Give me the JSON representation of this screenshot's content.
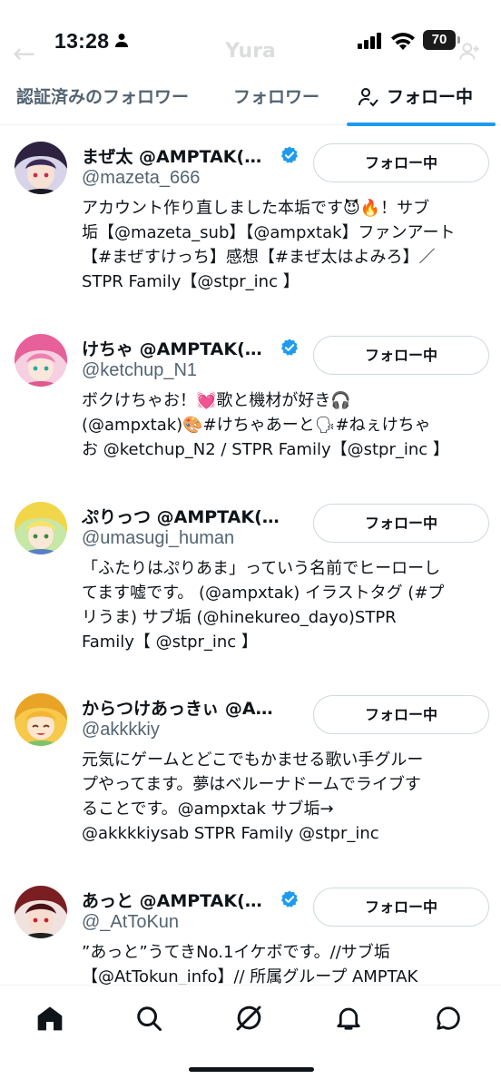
{
  "status_bar": {
    "time": "13:28",
    "battery": "70"
  },
  "header_ghost": {
    "title": "Yura"
  },
  "tabs": [
    {
      "label": "認証済みのフォロワー"
    },
    {
      "label": "フォロワー"
    },
    {
      "label": "フォロー中",
      "active": true
    }
  ],
  "users": [
    {
      "name": "まぜ太 @AMPTAK(ア…",
      "handle": "@mazeta_666",
      "button": "フォロー中",
      "verified": true,
      "bio": [
        "アカウント作り直しました本垢です😈🔥！サブ",
        "垢【@mazeta_sub】【@ampxtak】ファンアート",
        "【#まぜすけっち】感想【#まぜ太はよみろ】／",
        "STPR Family【@stpr_inc 】"
      ]
    },
    {
      "name": "けちゃ @AMPTAK(ア…",
      "handle": "@ketchup_N1",
      "button": "フォロー中",
      "verified": true,
      "bio": [
        "ボクけちゃお！💓歌と機材が好き🎧",
        "(@ampxtak)🎨#けちゃあーと🗣#ねぇけちゃ",
        "お @ketchup_N2 / STPR Family【@stpr_inc 】"
      ]
    },
    {
      "name": "ぷりっつ @AMPTAK(ア…",
      "handle": "@umasugi_human",
      "button": "フォロー中",
      "verified": false,
      "bio": [
        "「ふたりはぷりあま」っていう名前でヒーローし",
        "てます嘘です。 (@ampxtak) イラストタグ (#プ",
        "リうま) サブ垢 (@hinekureo_dayo)STPR",
        "Family【 @stpr_inc 】"
      ]
    },
    {
      "name": "からつけあっきぃ @AM…",
      "handle": "@akkkkiy",
      "button": "フォロー中",
      "verified": false,
      "bio": [
        "元気にゲームとどこでもかませる歌い手グルー",
        "プやってます。夢はベルーナドームでライブす",
        "ることです。@ampxtak サブ垢→",
        "@akkkkiysab STPR Family @stpr_inc"
      ]
    },
    {
      "name": "あっと @AMPTAK(ア…",
      "handle": "@_AtToKun",
      "button": "フォロー中",
      "verified": true,
      "bio": [
        "”あっと”うてきNo.1イケボです。//サブ垢",
        "【@AtTokun_info】// 所属グループ AMPTAK"
      ]
    }
  ],
  "bottom_nav": [
    "home-icon",
    "search-icon",
    "grok-icon",
    "notifications-icon",
    "messages-icon"
  ],
  "colors": {
    "accent": "#1d9bf0",
    "text": "#0f1419",
    "muted": "#536471",
    "border": "#cfd9de"
  }
}
